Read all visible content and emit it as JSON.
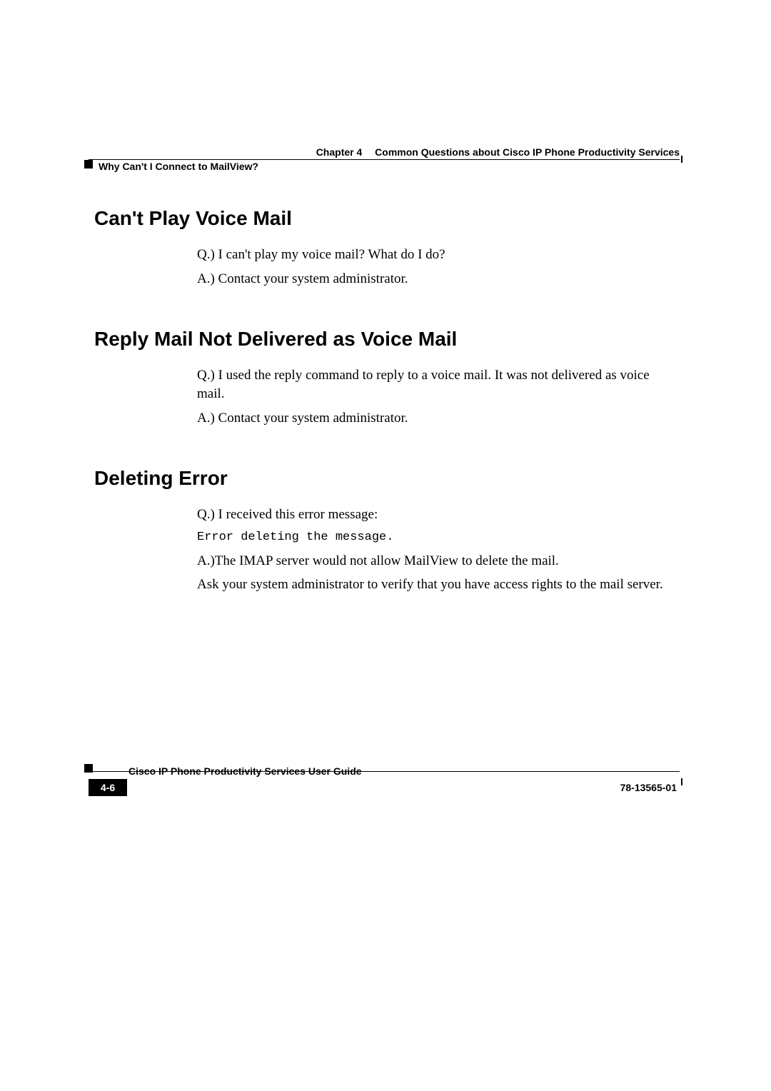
{
  "header": {
    "chapter_label": "Chapter 4",
    "chapter_title": "Common Questions about Cisco IP Phone Productivity Services",
    "section_label": "Why Can't I Connect to MailView?"
  },
  "sections": [
    {
      "heading": "Can't Play Voice Mail",
      "paragraphs": [
        {
          "text": "Q.) I can't play my voice mail? What do I do?",
          "code": false
        },
        {
          "text": "A.) Contact your system administrator.",
          "code": false
        }
      ]
    },
    {
      "heading": "Reply Mail Not Delivered as Voice Mail",
      "paragraphs": [
        {
          "text": "Q.) I used the reply command to reply to a voice mail. It was not delivered as voice mail.",
          "code": false
        },
        {
          "text": "A.) Contact your system administrator.",
          "code": false
        }
      ]
    },
    {
      "heading": "Deleting Error",
      "paragraphs": [
        {
          "text": "Q.) I received this error message:",
          "code": false
        },
        {
          "text": "Error deleting the message.",
          "code": true
        },
        {
          "text": "A.)The IMAP server would not allow MailView to delete the mail.",
          "code": false
        },
        {
          "text": "Ask your system administrator to verify that you have access rights to the mail server.",
          "code": false
        }
      ]
    }
  ],
  "footer": {
    "book_title": "Cisco IP Phone Productivity Services User Guide",
    "page_number": "4-6",
    "doc_number": "78-13565-01"
  }
}
